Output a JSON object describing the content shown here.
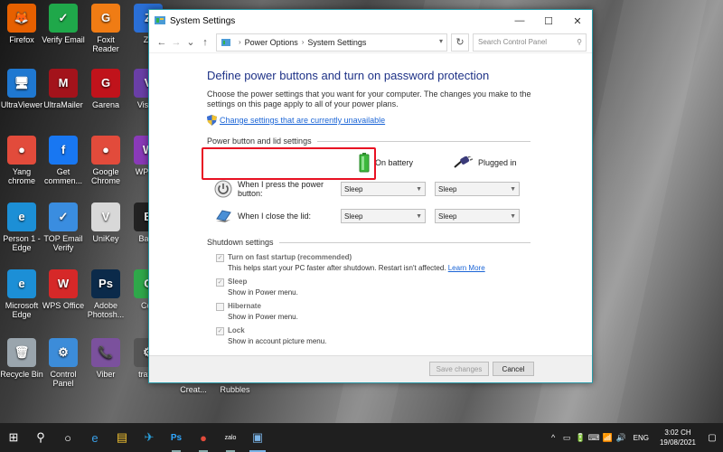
{
  "desktop": {
    "icons": [
      {
        "label": "Firefox",
        "color": "#e66000",
        "glyph": "🦊"
      },
      {
        "label": "Verify Email",
        "color": "#1fa84a",
        "glyph": "✓"
      },
      {
        "label": "Foxit Reader",
        "color": "#f07c14",
        "glyph": "G"
      },
      {
        "label": "Za",
        "color": "#2a6fd6",
        "glyph": "Z"
      },
      {
        "label": "UltraViewer",
        "color": "#1f78d1",
        "glyph": "🖥"
      },
      {
        "label": "UltraMailer",
        "color": "#a3131b",
        "glyph": "M"
      },
      {
        "label": "Garena",
        "color": "#c0131b",
        "glyph": "G"
      },
      {
        "label": "Visual",
        "color": "#6a3fa7",
        "glyph": "V"
      },
      {
        "label": "Yang chrome",
        "color": "#e24b3b",
        "glyph": "●"
      },
      {
        "label": "Get commen...",
        "color": "#1877f2",
        "glyph": "f"
      },
      {
        "label": "Google Chrome",
        "color": "#e24b3b",
        "glyph": "●"
      },
      {
        "label": "WPS F",
        "color": "#8a3ab9",
        "glyph": "W"
      },
      {
        "label": "Person 1 - Edge",
        "color": "#1c8fd6",
        "glyph": "e"
      },
      {
        "label": "TOP Email Verify",
        "color": "#3a8de0",
        "glyph": "✓"
      },
      {
        "label": "UniKey",
        "color": "#d8d8d8",
        "glyph": "V"
      },
      {
        "label": "Band",
        "color": "#222",
        "glyph": "B"
      },
      {
        "label": "Microsoft Edge",
        "color": "#1c8fd6",
        "glyph": "e"
      },
      {
        "label": "WPS Office",
        "color": "#d62828",
        "glyph": "W"
      },
      {
        "label": "Adobe Photosh...",
        "color": "#0b2a4a",
        "glyph": "Ps"
      },
      {
        "label": "Côc",
        "color": "#2fa84a",
        "glyph": "C"
      },
      {
        "label": "Recycle Bin",
        "color": "#9aa5ad",
        "glyph": "🗑"
      },
      {
        "label": "Control Panel",
        "color": "#3c8cd9",
        "glyph": "⚙"
      },
      {
        "label": "Viber",
        "color": "#7b519d",
        "glyph": "📞"
      },
      {
        "label": "traffic",
        "color": "#555",
        "glyph": "⚙"
      }
    ],
    "hidden_labels": [
      "Creat...",
      "Rubbles"
    ]
  },
  "window": {
    "title": "System Settings",
    "minimize": "—",
    "maximize": "☐",
    "close": "✕",
    "nav": {
      "back": "←",
      "forward": "→",
      "recent": "⌄",
      "up": "↑",
      "refresh": "↻"
    },
    "breadcrumb": {
      "sep": "›",
      "items": [
        "Power Options",
        "System Settings"
      ]
    },
    "search_placeholder": "Search Control Panel",
    "heading": "Define power buttons and turn on password protection",
    "description": "Choose the power settings that you want for your computer. The changes you make to the settings on this page apply to all of your power plans.",
    "change_link": "Change settings that are currently unavailable",
    "power_section": "Power button and lid settings",
    "col_battery": "On battery",
    "col_plugged": "Plugged in",
    "rows": [
      {
        "label": "When I press the power button:",
        "battery": "Sleep",
        "plugged": "Sleep"
      },
      {
        "label": "When I close the lid:",
        "battery": "Sleep",
        "plugged": "Sleep"
      }
    ],
    "shutdown_section": "Shutdown settings",
    "shutdown": [
      {
        "title": "Turn on fast startup (recommended)",
        "sub": "This helps start your PC faster after shutdown. Restart isn't affected.",
        "link": "Learn More",
        "checked": true
      },
      {
        "title": "Sleep",
        "sub": "Show in Power menu.",
        "checked": true
      },
      {
        "title": "Hibernate",
        "sub": "Show in Power menu.",
        "checked": false
      },
      {
        "title": "Lock",
        "sub": "Show in account picture menu.",
        "checked": true
      }
    ],
    "save_label": "Save changes",
    "cancel_label": "Cancel"
  },
  "taskbar": {
    "items": [
      "⊞",
      "⚲",
      "○",
      "e",
      "▤",
      "✈",
      "Ps",
      "●",
      "zalo",
      "▣"
    ],
    "tray": {
      "icons": [
        "^",
        "▭",
        "🔋",
        "⌨",
        "📶",
        "🔊"
      ],
      "lang": "ENG",
      "time": "3:02 CH",
      "date": "19/08/2021",
      "notifications": "▢"
    }
  },
  "colors": {
    "accent_link": "#1a64d6",
    "heading": "#1e3287",
    "highlight_box": "#e81123",
    "window_border": "#2b9aa8"
  }
}
